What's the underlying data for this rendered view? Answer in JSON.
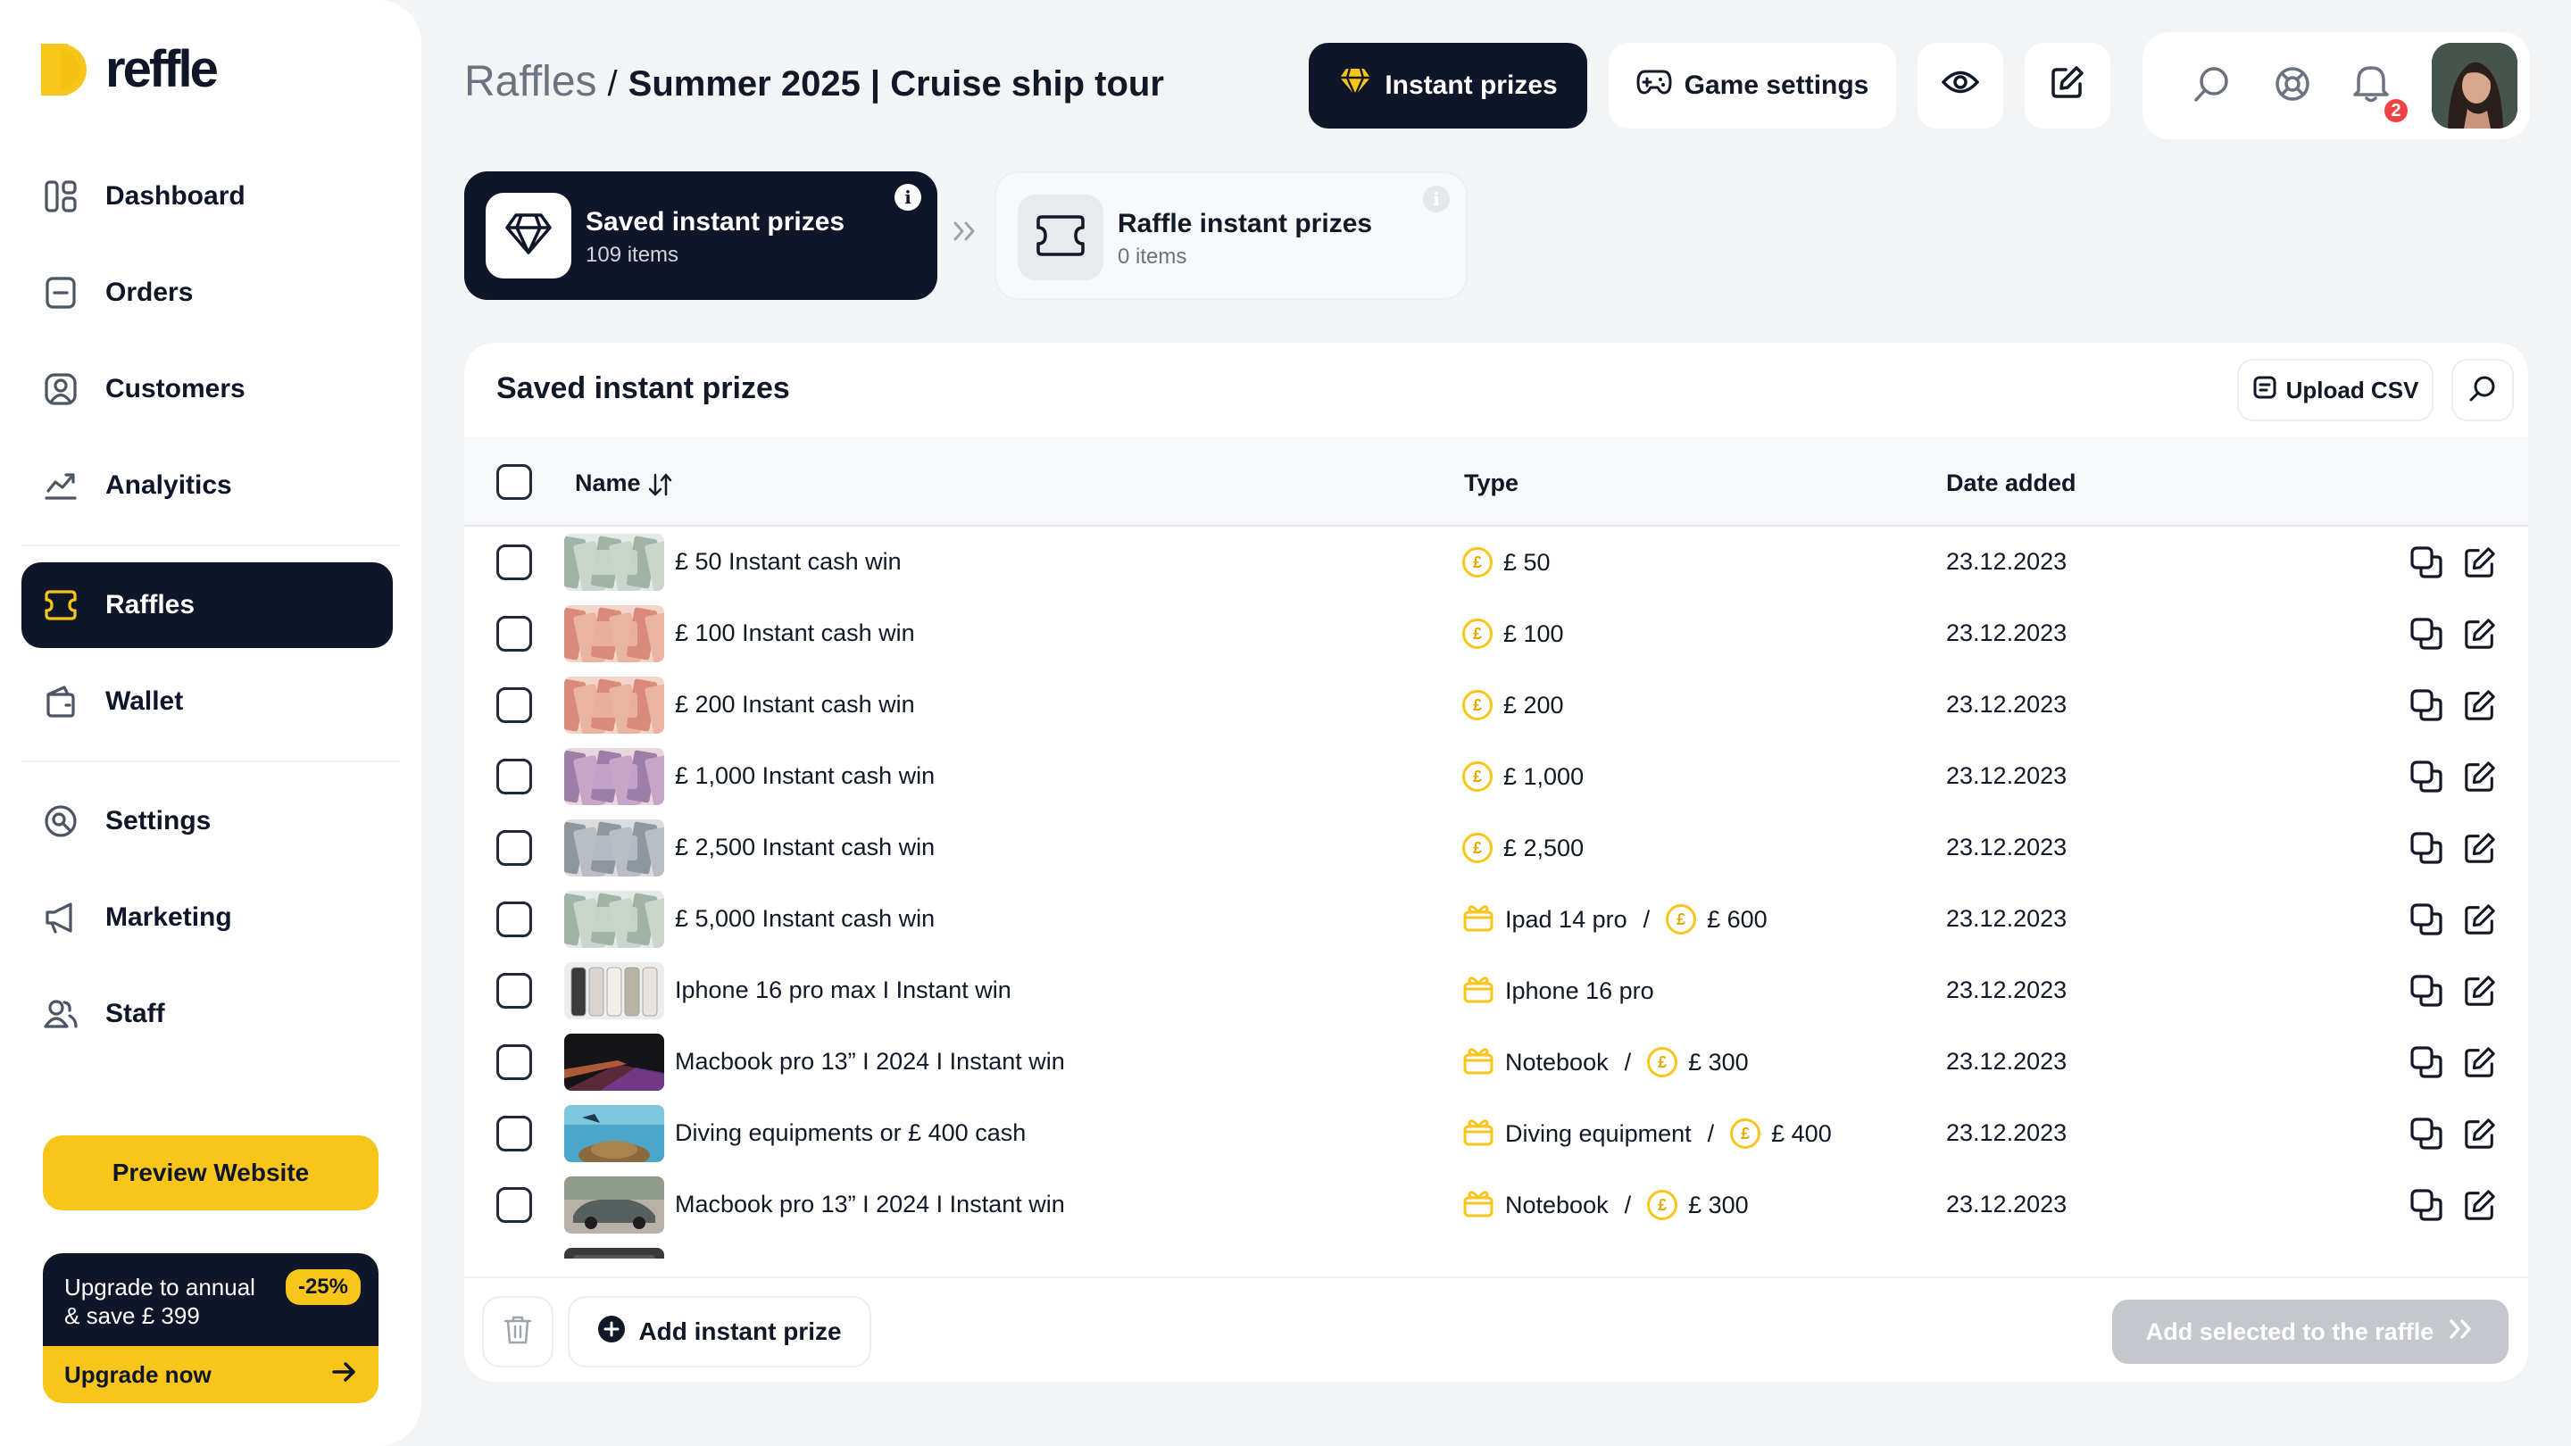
{
  "brand": {
    "name": "reffle",
    "accent": "#F8C51B",
    "dark": "#0F1629"
  },
  "sidebar": {
    "items": [
      {
        "label": "Dashboard",
        "icon": "dashboard-icon",
        "active": false
      },
      {
        "label": "Orders",
        "icon": "orders-icon",
        "active": false
      },
      {
        "label": "Customers",
        "icon": "customers-icon",
        "active": false
      },
      {
        "label": "Analyitics",
        "icon": "analytics-icon",
        "active": false
      },
      {
        "label": "Raffles",
        "icon": "ticket-icon",
        "active": true
      },
      {
        "label": "Wallet",
        "icon": "wallet-icon",
        "active": false
      },
      {
        "label": "Settings",
        "icon": "settings-icon",
        "active": false
      },
      {
        "label": "Marketing",
        "icon": "megaphone-icon",
        "active": false
      },
      {
        "label": "Staff",
        "icon": "staff-icon",
        "active": false
      }
    ],
    "preview_label": "Preview Website",
    "upgrade": {
      "line1": "Upgrade to annual",
      "line2": "& save £ 399",
      "badge": "-25%",
      "cta": "Upgrade now"
    }
  },
  "header": {
    "breadcrumb_root": "Raffles",
    "breadcrumb_sep": "/",
    "breadcrumb_current": "Summer 2025 | Cruise ship tour",
    "instant_prizes_label": "Instant prizes",
    "game_settings_label": "Game settings",
    "notifications_count": "2"
  },
  "tabs": [
    {
      "title": "Saved instant prizes",
      "subtitle": "109 items"
    },
    {
      "title": "Raffle instant prizes",
      "subtitle": "0 items"
    }
  ],
  "table": {
    "title": "Saved instant prizes",
    "upload_label": "Upload CSV",
    "columns": {
      "name": "Name",
      "type": "Type",
      "date": "Date added"
    },
    "rows": [
      {
        "name": "£ 50 Instant cash win",
        "thumb": "cash",
        "type": [
          {
            "kind": "cash",
            "text": "£ 50"
          }
        ],
        "date": "23.12.2023"
      },
      {
        "name": "£ 100 Instant cash win",
        "thumb": "cash-pink",
        "type": [
          {
            "kind": "cash",
            "text": "£ 100"
          }
        ],
        "date": "23.12.2023"
      },
      {
        "name": "£ 200 Instant cash win",
        "thumb": "cash-pink",
        "type": [
          {
            "kind": "cash",
            "text": "£ 200"
          }
        ],
        "date": "23.12.2023"
      },
      {
        "name": "£ 1,000 Instant cash win",
        "thumb": "cash-purple",
        "type": [
          {
            "kind": "cash",
            "text": "£ 1,000"
          }
        ],
        "date": "23.12.2023"
      },
      {
        "name": "£ 2,500 Instant cash win",
        "thumb": "cash-grey",
        "type": [
          {
            "kind": "cash",
            "text": "£ 2,500"
          }
        ],
        "date": "23.12.2023"
      },
      {
        "name": "£ 5,000 Instant cash win",
        "thumb": "cash",
        "type": [
          {
            "kind": "gift",
            "text": "Ipad 14 pro"
          },
          {
            "kind": "cash",
            "text": "£ 600"
          }
        ],
        "date": "23.12.2023"
      },
      {
        "name": "Iphone 16 pro max I Instant win",
        "thumb": "phones",
        "type": [
          {
            "kind": "gift",
            "text": "Iphone 16 pro"
          }
        ],
        "date": "23.12.2023"
      },
      {
        "name": "Macbook pro 13” I 2024 I Instant win",
        "thumb": "laptop",
        "type": [
          {
            "kind": "gift",
            "text": "Notebook"
          },
          {
            "kind": "cash",
            "text": "£ 300"
          }
        ],
        "date": "23.12.2023"
      },
      {
        "name": "Diving equipments or £ 400 cash",
        "thumb": "diving",
        "type": [
          {
            "kind": "gift",
            "text": "Diving equipment"
          },
          {
            "kind": "cash",
            "text": "£ 400"
          }
        ],
        "date": "23.12.2023"
      },
      {
        "name": "Macbook pro 13” I 2024 I Instant win",
        "thumb": "car",
        "type": [
          {
            "kind": "gift",
            "text": "Notebook"
          },
          {
            "kind": "cash",
            "text": "£ 300"
          }
        ],
        "date": "23.12.2023"
      },
      {
        "name": "",
        "thumb": "dark",
        "type": [],
        "date": ""
      }
    ],
    "separator": "/",
    "add_label": "Add instant prize",
    "add_selected_label": "Add selected to the raffle"
  }
}
